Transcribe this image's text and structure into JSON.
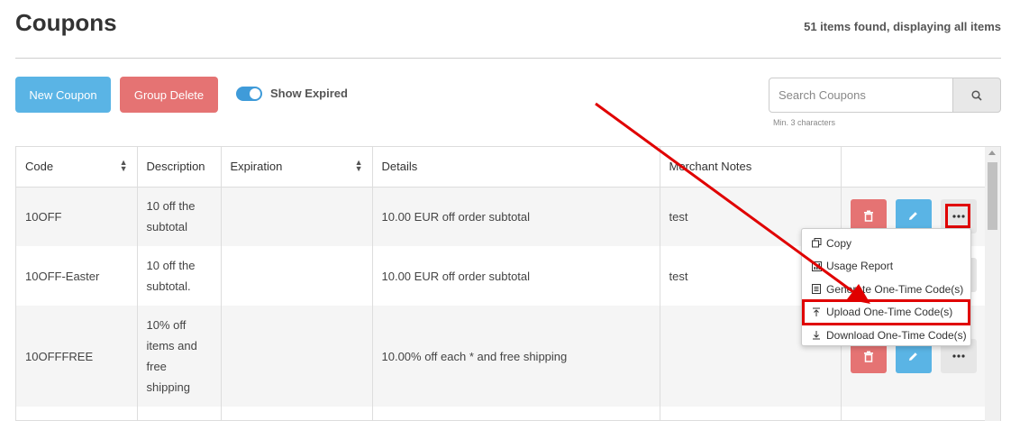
{
  "header": {
    "title": "Coupons",
    "items_count": "51 items found, displaying all items"
  },
  "toolbar": {
    "new_coupon_label": "New Coupon",
    "group_delete_label": "Group Delete",
    "show_expired_label": "Show Expired",
    "show_expired_on": true
  },
  "search": {
    "placeholder": "Search Coupons",
    "value": "",
    "hint": "Min. 3 characters"
  },
  "table": {
    "columns": [
      "Code",
      "Description",
      "Expiration",
      "Details",
      "Merchant Notes"
    ],
    "rows": [
      {
        "code": "10OFF",
        "description": [
          "10 off the",
          "subtotal"
        ],
        "expiration": "",
        "details": "10.00 EUR off order subtotal",
        "notes": "test"
      },
      {
        "code": "10OFF-Easter",
        "description": [
          "10 off the",
          "subtotal."
        ],
        "expiration": "",
        "details": "10.00 EUR off order subtotal",
        "notes": "test"
      },
      {
        "code": "10OFFFREE",
        "description": [
          "10% off",
          "items and",
          "free",
          "shipping"
        ],
        "expiration": "",
        "details": "10.00% off each * and free shipping",
        "notes": ""
      }
    ]
  },
  "dropdown": {
    "items": [
      {
        "label": "Copy",
        "icon": "copy-icon"
      },
      {
        "label": "Usage Report",
        "icon": "chart-icon"
      },
      {
        "label": "Generate One-Time Code(s)",
        "icon": "document-icon"
      },
      {
        "label": "Upload One-Time Code(s)",
        "icon": "upload-icon"
      },
      {
        "label": "Download One-Time Code(s)",
        "icon": "download-icon"
      }
    ]
  },
  "colors": {
    "primary": "#5ab4e5",
    "danger": "#e57373",
    "annotation": "#e00000"
  }
}
